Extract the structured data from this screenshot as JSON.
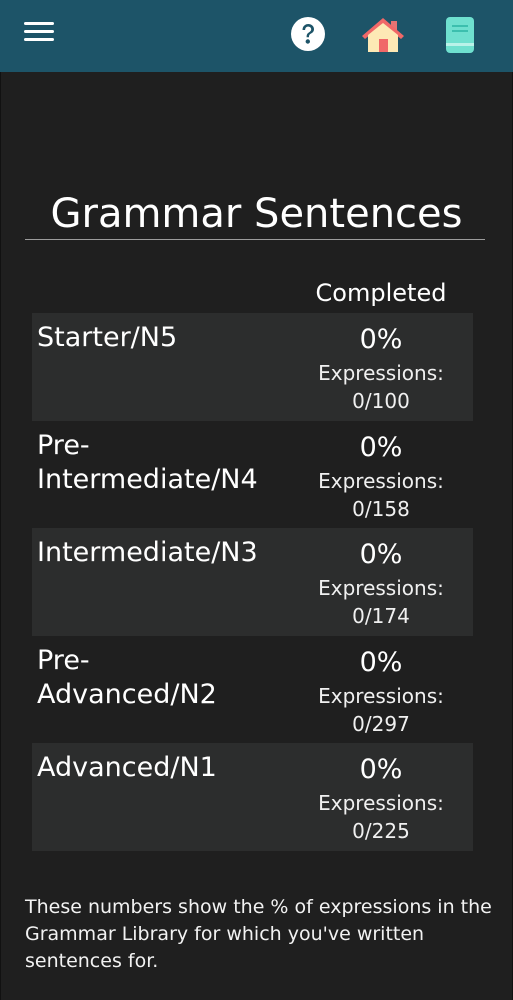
{
  "header": {
    "menu_icon": "hamburger-menu-icon",
    "help_icon": "question-circle-icon",
    "home_icon": "home-icon",
    "book_icon": "notebook-icon",
    "bar_color": "#1d5468"
  },
  "page": {
    "title": "Grammar Sentences",
    "completed_header": "Completed",
    "footnote": "These numbers show the % of expressions in the Grammar Library for which you've written sentences for."
  },
  "levels": [
    {
      "name": "Starter/N5",
      "percent": "0%",
      "expressions": "Expressions: 0/100"
    },
    {
      "name": "Pre-\nIntermediate/N4",
      "percent": "0%",
      "expressions": "Expressions: 0/158"
    },
    {
      "name": "Intermediate/N3",
      "percent": "0%",
      "expressions": "Expressions: 0/174"
    },
    {
      "name": "Pre-\nAdvanced/N2",
      "percent": "0%",
      "expressions": "Expressions: 0/297"
    },
    {
      "name": "Advanced/N1",
      "percent": "0%",
      "expressions": "Expressions: 0/225"
    }
  ]
}
